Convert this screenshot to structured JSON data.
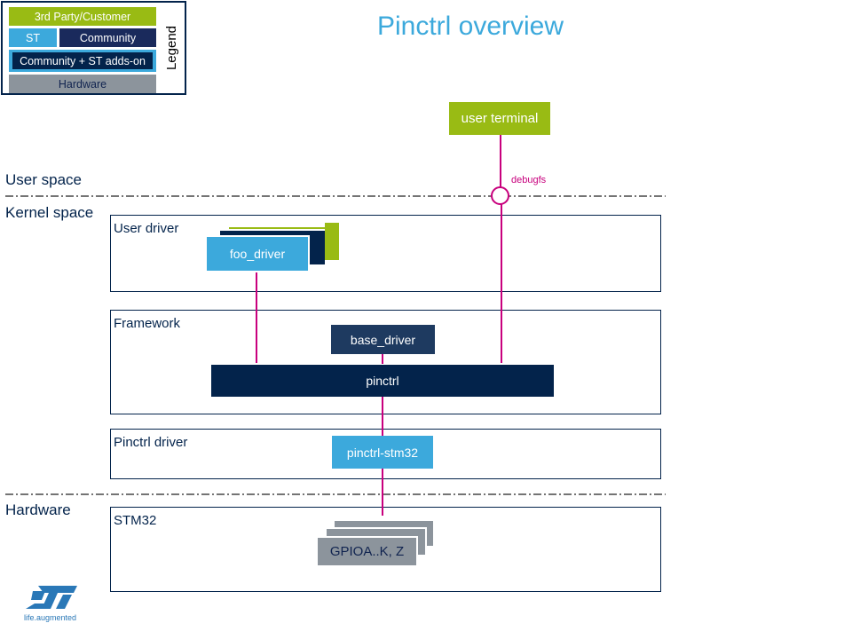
{
  "title": "Pinctrl overview",
  "legend": {
    "title": "Legend",
    "entries": [
      {
        "label": "3rd Party/Customer",
        "color": "#99bb14"
      },
      {
        "label": "ST",
        "color": "#3ca9dc"
      },
      {
        "label": "Community",
        "color": "#1a2a5c"
      },
      {
        "label": "Community + ST adds-on",
        "color": "#03234b"
      },
      {
        "label": "Hardware",
        "color": "#8c949c"
      }
    ]
  },
  "spaces": {
    "user": "User space",
    "kernel": "Kernel space",
    "hardware": "Hardware"
  },
  "layers": {
    "user_driver": "User driver",
    "framework": "Framework",
    "pinctrl_driver": "Pinctrl driver",
    "stm32": "STM32"
  },
  "nodes": {
    "user_terminal": "user terminal",
    "foo_driver": "foo_driver",
    "base_driver": "base_driver",
    "pinctrl": "pinctrl",
    "pinctrl_stm32": "pinctrl-stm32",
    "gpio": "GPIOA..K, Z"
  },
  "interfaces": {
    "debugfs": "debugfs"
  },
  "colors": {
    "third_party": "#99bb14",
    "st": "#3ca9dc",
    "community": "#1a2a5c",
    "community_st": "#03234b",
    "hardware": "#8c949c",
    "connector": "#c8007d"
  },
  "logo": {
    "tagline": "life.augmented"
  }
}
